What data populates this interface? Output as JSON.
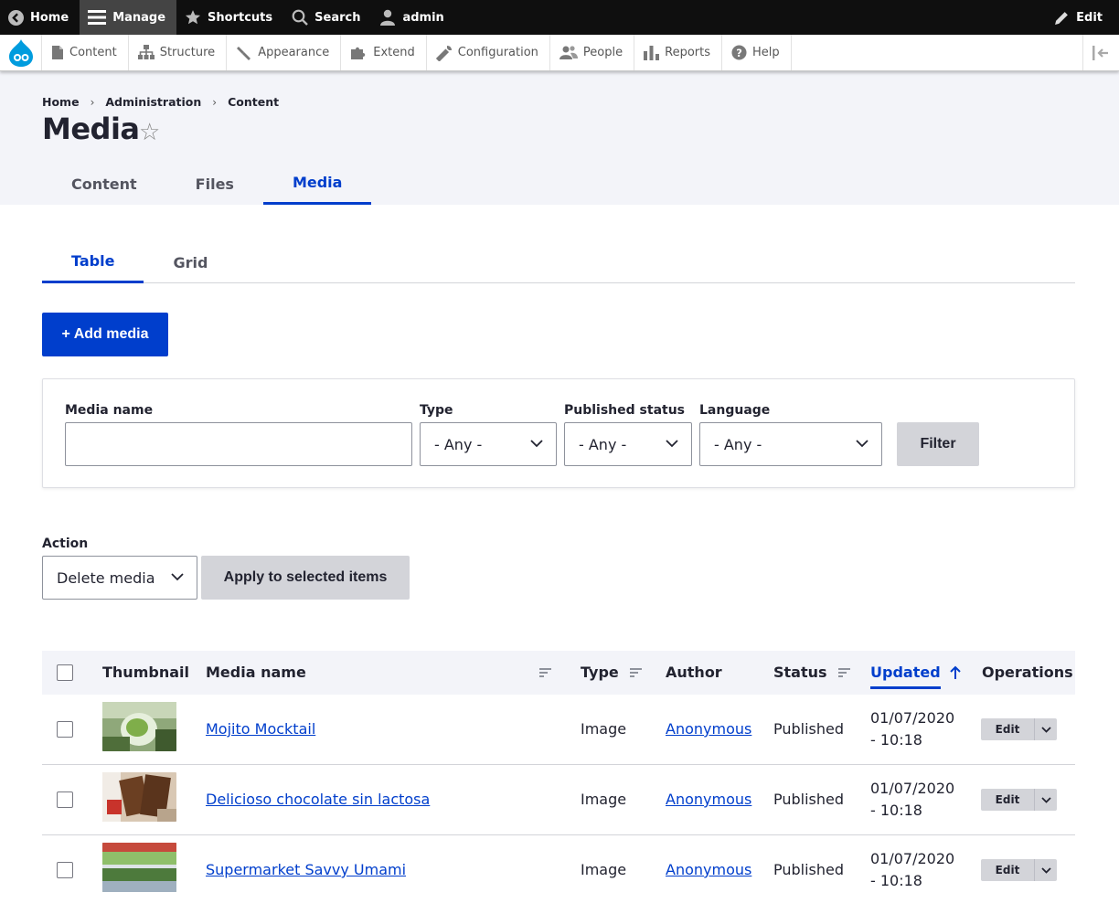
{
  "toolbar": {
    "home": "Home",
    "manage": "Manage",
    "shortcuts": "Shortcuts",
    "search": "Search",
    "user": "admin",
    "edit": "Edit"
  },
  "tray": {
    "items": [
      "Content",
      "Structure",
      "Appearance",
      "Extend",
      "Configuration",
      "People",
      "Reports",
      "Help"
    ]
  },
  "breadcrumb": [
    "Home",
    "Administration",
    "Content"
  ],
  "page": {
    "title": "Media"
  },
  "primary_tabs": [
    "Content",
    "Files",
    "Media"
  ],
  "secondary_tabs": [
    "Table",
    "Grid"
  ],
  "add_button": "+ Add media",
  "filters": {
    "media_name_label": "Media name",
    "media_name_value": "",
    "type_label": "Type",
    "type_value": "- Any -",
    "status_label": "Published status",
    "status_value": "- Any -",
    "language_label": "Language",
    "language_value": "- Any -",
    "filter_button": "Filter"
  },
  "bulk": {
    "action_label": "Action",
    "action_value": "Delete media",
    "apply_button": "Apply to selected items"
  },
  "table": {
    "headers": {
      "thumbnail": "Thumbnail",
      "name": "Media name",
      "type": "Type",
      "author": "Author",
      "status": "Status",
      "updated": "Updated",
      "operations": "Operations"
    },
    "rows": [
      {
        "name": "Mojito Mocktail",
        "type": "Image",
        "author": "Anonymous",
        "status": "Published",
        "date": "01/07/2020",
        "time": "- 10:18",
        "edit": "Edit"
      },
      {
        "name": "Delicioso chocolate sin lactosa",
        "type": "Image",
        "author": "Anonymous",
        "status": "Published",
        "date": "01/07/2020",
        "time": "- 10:18",
        "edit": "Edit"
      },
      {
        "name": "Supermarket Savvy Umami",
        "type": "Image",
        "author": "Anonymous",
        "status": "Published",
        "date": "01/07/2020",
        "time": "- 10:18",
        "edit": "Edit"
      }
    ]
  },
  "colors": {
    "accent": "#003ecc",
    "toolbar_bg": "#0f0f0f",
    "header_bg": "#f3f4f9",
    "button_grey": "#d3d4d9"
  }
}
